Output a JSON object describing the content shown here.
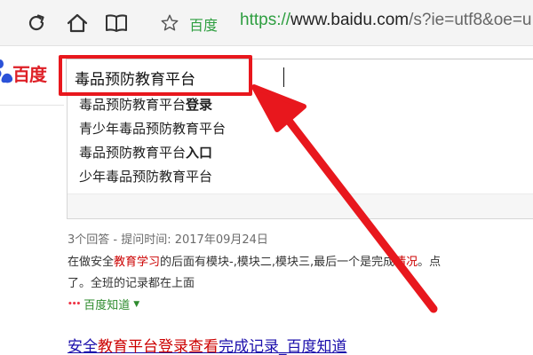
{
  "browser": {
    "icons": [
      "refresh-icon",
      "home-icon",
      "reading-book-icon",
      "favorite-star-icon"
    ],
    "site_label": "百度",
    "url_proto": "https://",
    "url_host": "www.baidu.com",
    "url_path": "/s?ie=utf8&oe=u"
  },
  "logo": {
    "text": "百度"
  },
  "search": {
    "value": "毒品预防教育平台"
  },
  "suggestions": [
    {
      "plain": "毒品预防教育平台",
      "bold": "登录"
    },
    {
      "plain": "青少年毒品预防教育平台",
      "bold": ""
    },
    {
      "plain": "毒品预防教育平台",
      "bold": "入口"
    },
    {
      "plain": "少年毒品预防教育平台",
      "bold": ""
    }
  ],
  "result": {
    "meta": "3个回答 - 提问时间: 2017年09月24日",
    "snippet1_a": "在做安全",
    "snippet1_kw1": "教育学习",
    "snippet1_b": "的后面有模块-,模块二,模块三,最后一个是完成",
    "snippet1_kw2": "情况",
    "snippet1_c": "。点",
    "snippet2": "了。全班的记录都在上面",
    "source_logo": "•••",
    "source": "百度知道",
    "title_a": "安全",
    "title_kw": "教育平台登录查看",
    "title_b": "完成记录_百度知道"
  },
  "colors": {
    "accent_red": "#e8171d",
    "link_blue": "#1a0dab",
    "green": "#2e9e40"
  }
}
